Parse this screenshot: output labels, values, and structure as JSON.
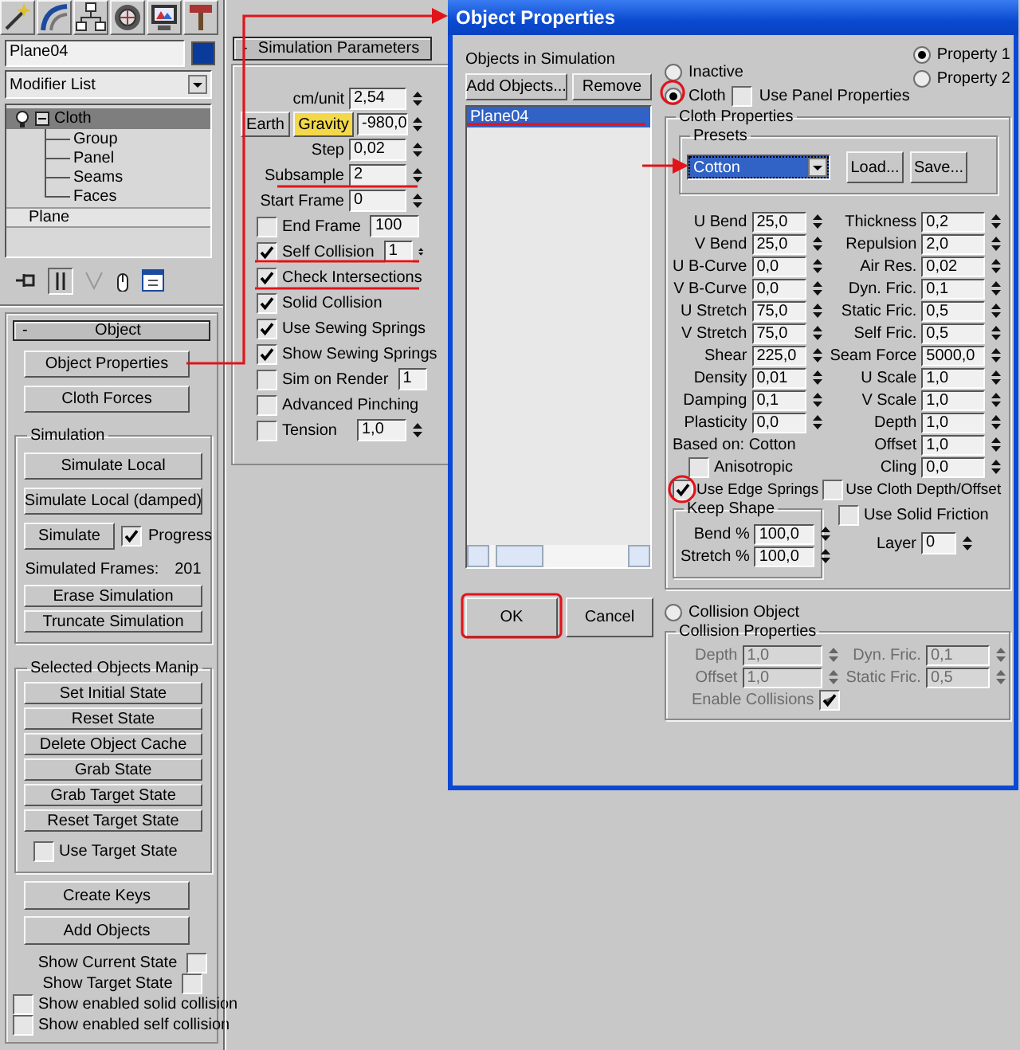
{
  "command_panel": {
    "object_name": "Plane04",
    "modifier_list": "Modifier List",
    "modifier_stack": [
      {
        "label": "Cloth",
        "selected": true,
        "expanded": true,
        "children": [
          {
            "label": "Group",
            "selected": false
          },
          {
            "label": "Panel",
            "selected": false
          },
          {
            "label": "Seams",
            "selected": false
          },
          {
            "label": "Faces",
            "selected": false
          }
        ]
      },
      {
        "label": "Plane",
        "selected": false
      }
    ],
    "rollout": {
      "toggle": "-",
      "title": "Object"
    },
    "object_buttons": [
      "Object Properties",
      "Cloth Forces"
    ],
    "simulation": {
      "title": "Simulation",
      "items": [
        {
          "kind": "button",
          "label": "Simulate Local"
        },
        {
          "kind": "button",
          "label": "Simulate Local (damped)"
        },
        {
          "kind": "button_check",
          "label": "Simulate",
          "check_label": "Progress",
          "checked": true
        },
        {
          "kind": "readout",
          "label": "Simulated Frames:",
          "value": "201"
        },
        {
          "kind": "button",
          "label": "Erase Simulation"
        },
        {
          "kind": "button",
          "label": "Truncate Simulation"
        }
      ]
    },
    "manip": {
      "title": "Selected Objects Manip",
      "buttons": [
        "Set Initial State",
        "Reset State",
        "Delete Object Cache",
        "Grab State",
        "Grab Target State",
        "Reset Target State"
      ],
      "use_target_state": {
        "label": "Use Target State",
        "checked": false
      }
    },
    "bottom_buttons": [
      "Create Keys",
      "Add Objects"
    ],
    "show_options": [
      {
        "kind": "check_right",
        "label": "Show Current State",
        "checked": false
      },
      {
        "kind": "check_right",
        "label": "Show Target State",
        "checked": false
      },
      {
        "kind": "check_left",
        "label": "Show enabled solid collision",
        "checked": false
      },
      {
        "kind": "check_left",
        "label": "Show enabled self collision",
        "checked": false
      }
    ]
  },
  "simulation_parameters": {
    "toggle": "-",
    "title": "Simulation Parameters",
    "rows": [
      {
        "kind": "spinner",
        "label": "cm/unit",
        "value": "2,54"
      },
      {
        "kind": "gravity",
        "button": "Earth",
        "label": "Gravity",
        "active": true,
        "value": "-980,0"
      },
      {
        "kind": "spinner",
        "label": "Step",
        "value": "0,02"
      },
      {
        "kind": "spinner",
        "label": "Subsample",
        "value": "2"
      },
      {
        "kind": "spinner",
        "label": "Start Frame",
        "value": "0"
      },
      {
        "kind": "check_spinner",
        "label": "End Frame",
        "checked": false,
        "value": "100"
      },
      {
        "kind": "check_spinner",
        "label": "Self Collision",
        "checked": true,
        "value": "1"
      },
      {
        "kind": "check",
        "label": "Check Intersections",
        "checked": true
      },
      {
        "kind": "check",
        "label": "Solid Collision",
        "checked": true
      },
      {
        "kind": "check",
        "label": "Use Sewing Springs",
        "checked": true
      },
      {
        "kind": "check",
        "label": "Show Sewing Springs",
        "checked": true
      },
      {
        "kind": "check_spinner",
        "label": "Sim on Render",
        "checked": false,
        "value": "1"
      },
      {
        "kind": "check",
        "label": "Advanced Pinching",
        "checked": false
      },
      {
        "kind": "check_spinner",
        "label": "Tension",
        "checked": false,
        "value": "1,0"
      }
    ]
  },
  "dialog": {
    "title": "Object Properties",
    "objects_label": "Objects in Simulation",
    "add_button": "Add Objects...",
    "remove_button": "Remove",
    "objects": [
      {
        "label": "Plane04",
        "selected": true
      }
    ],
    "ok": "OK",
    "cancel": "Cancel",
    "mode_radios": [
      {
        "label": "Inactive",
        "selected": false
      },
      {
        "label": "Cloth",
        "selected": true
      }
    ],
    "use_panel_properties": {
      "label": "Use Panel Properties",
      "checked": false
    },
    "property_radios": [
      {
        "label": "Property 1",
        "selected": true
      },
      {
        "label": "Property 2",
        "selected": false
      }
    ],
    "cloth_properties": {
      "title": "Cloth Properties",
      "presets_title": "Presets",
      "preset": "Cotton",
      "load": "Load...",
      "save": "Save...",
      "left_params": [
        {
          "label": "U Bend",
          "value": "25,0"
        },
        {
          "label": "V Bend",
          "value": "25,0"
        },
        {
          "label": "U B-Curve",
          "value": "0,0"
        },
        {
          "label": "V B-Curve",
          "value": "0,0"
        },
        {
          "label": "U Stretch",
          "value": "75,0"
        },
        {
          "label": "V Stretch",
          "value": "75,0"
        },
        {
          "label": "Shear",
          "value": "225,0"
        },
        {
          "label": "Density",
          "value": "0,01"
        },
        {
          "label": "Damping",
          "value": "0,1"
        },
        {
          "label": "Plasticity",
          "value": "0,0"
        }
      ],
      "right_params": [
        {
          "label": "Thickness",
          "value": "0,2"
        },
        {
          "label": "Repulsion",
          "value": "2,0"
        },
        {
          "label": "Air Res.",
          "value": "0,02"
        },
        {
          "label": "Dyn. Fric.",
          "value": "0,1"
        },
        {
          "label": "Static Fric.",
          "value": "0,5"
        },
        {
          "label": "Self Fric.",
          "value": "0,5"
        },
        {
          "label": "Seam Force",
          "value": "5000,0"
        },
        {
          "label": "U Scale",
          "value": "1,0"
        },
        {
          "label": "V Scale",
          "value": "1,0"
        },
        {
          "label": "Depth",
          "value": "1,0"
        },
        {
          "label": "Offset",
          "value": "1,0"
        },
        {
          "label": "Cling",
          "value": "0,0"
        }
      ],
      "based_on": "Based on: Cotton",
      "anisotropic": {
        "label": "Anisotropic",
        "checked": false
      },
      "use_edge_springs": {
        "label": "Use Edge Springs",
        "checked": true
      },
      "use_cloth_depth_offset": {
        "label": "Use Cloth Depth/Offset",
        "checked": false
      },
      "keep_shape": {
        "title": "Keep Shape",
        "params": [
          {
            "label": "Bend %",
            "value": "100,0"
          },
          {
            "label": "Stretch %",
            "value": "100,0"
          }
        ]
      },
      "use_solid_friction": {
        "label": "Use Solid Friction",
        "checked": false
      },
      "layer": {
        "label": "Layer",
        "value": "0"
      }
    },
    "collision_object": {
      "label": "Collision Object",
      "selected": false
    },
    "collision_properties": {
      "title": "Collision Properties",
      "disabled": true,
      "left_params": [
        {
          "label": "Depth",
          "value": "1,0"
        },
        {
          "label": "Offset",
          "value": "1,0"
        }
      ],
      "right_params": [
        {
          "label": "Dyn. Fric.",
          "value": "0,1"
        },
        {
          "label": "Static Fric.",
          "value": "0,5"
        }
      ],
      "enable_collisions": {
        "label": "Enable Collisions",
        "checked": true
      }
    }
  }
}
